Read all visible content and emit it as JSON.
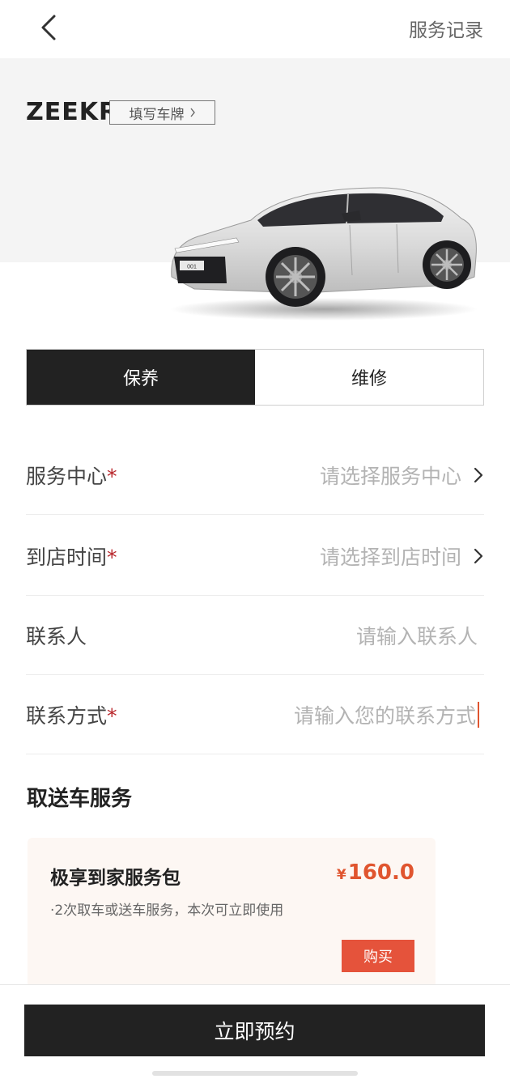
{
  "header": {
    "service_record": "服务记录"
  },
  "car": {
    "brand": "ZEEKR",
    "plate_button": "填写车牌",
    "model_badge": "001"
  },
  "tabs": [
    {
      "label": "保养",
      "active": true
    },
    {
      "label": "维修",
      "active": false
    }
  ],
  "form": {
    "service_center": {
      "label": "服务中心",
      "required": "*",
      "placeholder": "请选择服务中心"
    },
    "arrival_time": {
      "label": "到店时间",
      "required": "*",
      "placeholder": "请选择到店时间"
    },
    "contact_person": {
      "label": "联系人",
      "placeholder": "请输入联系人"
    },
    "contact_method": {
      "label": "联系方式",
      "required": "*",
      "placeholder": "请输入您的联系方式"
    }
  },
  "pickup_service": {
    "title": "取送车服务",
    "package": {
      "name": "极享到家服务包",
      "currency": "¥",
      "price": "160.0",
      "description": "·2次取车或送车服务，本次可立即使用",
      "buy_label": "购买"
    }
  },
  "footer": {
    "book_label": "立即预约"
  },
  "colors": {
    "accent": "#e0552f",
    "dark": "#222222",
    "required": "#b8262b"
  }
}
